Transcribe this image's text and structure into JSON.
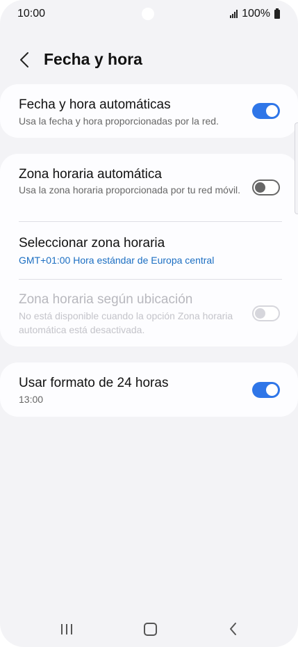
{
  "status_bar": {
    "time": "10:00",
    "battery": "100%"
  },
  "header": {
    "title": "Fecha y hora",
    "back_icon": "chevron-left-icon"
  },
  "settings": {
    "auto_datetime": {
      "title": "Fecha y hora automáticas",
      "subtitle": "Usa la fecha y hora proporcionadas por la red.",
      "enabled": true
    },
    "auto_timezone": {
      "title": "Zona horaria automática",
      "subtitle": "Usa la zona horaria proporcionada por tu red móvil.",
      "enabled": false
    },
    "select_timezone": {
      "title": "Seleccionar zona horaria",
      "value": "GMT+01:00 Hora estándar de Europa central"
    },
    "location_timezone": {
      "title": "Zona horaria según ubicación",
      "subtitle": "No está disponible cuando la opción Zona horaria automática está desactivada.",
      "enabled": false,
      "disabled": true
    },
    "format_24h": {
      "title": "Usar formato de 24 horas",
      "subtitle": "13:00",
      "enabled": true
    }
  },
  "colors": {
    "accent": "#2f76e8",
    "link": "#1b6ec2",
    "background": "#f3f3f6",
    "card": "#fdfdff"
  },
  "nav_bar": {
    "icons": [
      "recents-icon",
      "home-icon",
      "back-icon"
    ]
  }
}
